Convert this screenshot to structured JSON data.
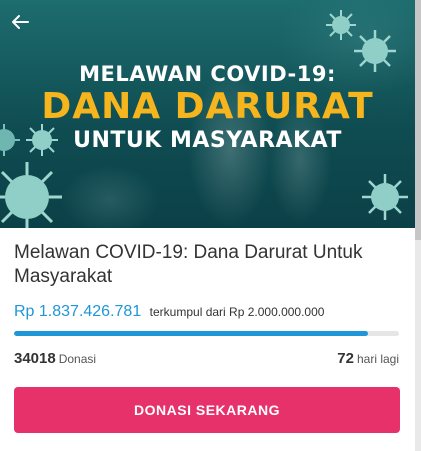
{
  "banner": {
    "line1": "MELAWAN COVID-19:",
    "line2": "DANA DARURAT",
    "line3": "UNTUK MASYARAKAT"
  },
  "nav": {
    "back_icon": "arrow-left-icon"
  },
  "campaign": {
    "title": "Melawan COVID-19: Dana Darurat Untuk Masyarakat",
    "collected": "Rp 1.837.426.781",
    "target_text": "terkumpul dari Rp 2.000.000.000",
    "progress_fraction": 0.9187,
    "donations_count": "34018",
    "donations_label": "Donasi",
    "days_left": "72",
    "days_label": "hari lagi"
  },
  "cta": {
    "label": "DONASI SEKARANG"
  },
  "colors": {
    "accent_blue": "#1f96d8",
    "cta_pink": "#e7316a",
    "banner_teal": "#1d6c6e",
    "banner_gold": "#f6b51d"
  }
}
